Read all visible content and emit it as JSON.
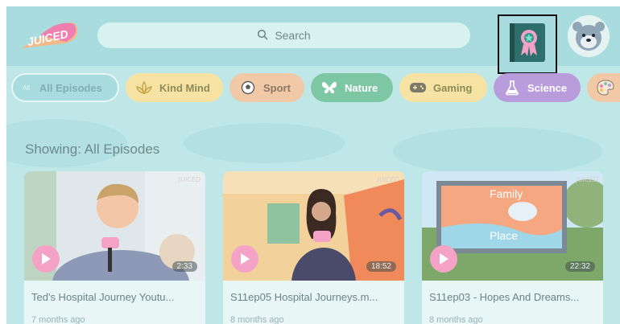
{
  "header": {
    "logo_text": "JUICED",
    "search_placeholder": "Search"
  },
  "categories": [
    {
      "badge": "All",
      "label": "All Episodes",
      "icon": "all-badge"
    },
    {
      "label": "Kind Mind",
      "icon": "lotus-icon"
    },
    {
      "label": "Sport",
      "icon": "soccer-ball-icon"
    },
    {
      "label": "Nature",
      "icon": "butterfly-icon"
    },
    {
      "label": "Gaming",
      "icon": "gamepad-icon"
    },
    {
      "label": "Science",
      "icon": "flask-icon"
    },
    {
      "label": "",
      "icon": "palette-icon"
    }
  ],
  "showing": "Showing: All Episodes",
  "episodes": [
    {
      "title": "Ted's Hospital Journey Youtu...",
      "duration": "2:33",
      "date": "7 months ago"
    },
    {
      "title": "S11ep05 Hospital Journeys.m...",
      "duration": "18:52",
      "date": "8 months ago"
    },
    {
      "title": "S11ep03 - Hopes And Dreams...",
      "duration": "22:32",
      "date": "8 months ago",
      "sign_text": [
        "Family",
        "Place"
      ]
    }
  ],
  "colors": {
    "background": "#bfe7e8",
    "header": "#a9dcde",
    "play_button": "#f4a3c7",
    "kind_mind": "#f6e3a4",
    "sport": "#f2c9a6",
    "nature": "#7dc7a4",
    "science": "#b99cdc"
  }
}
